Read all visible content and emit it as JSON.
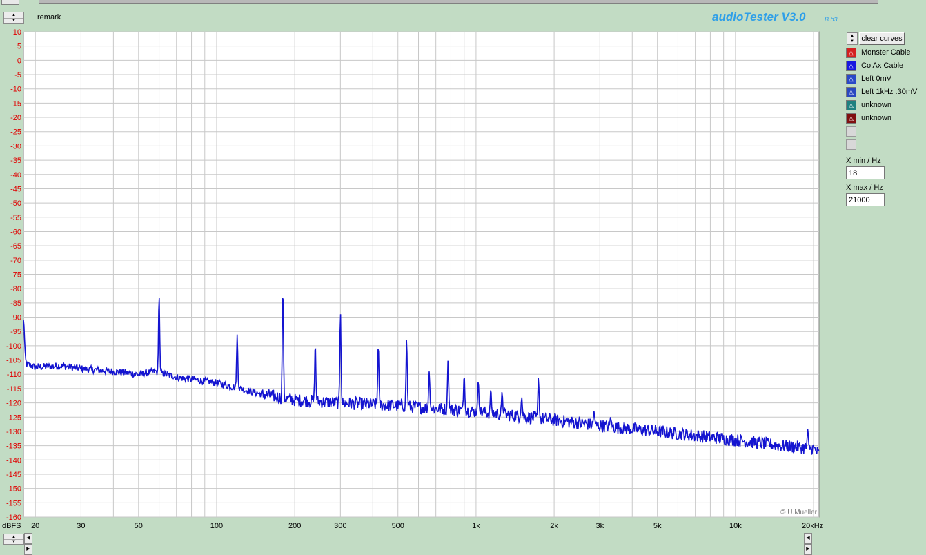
{
  "app": {
    "title": "audioTester V3.0",
    "subtitle": "B b3",
    "remark_label": "remark"
  },
  "legend": {
    "clear_label": "clear curves",
    "items": [
      {
        "label": "Monster Cable",
        "color": "#d42020"
      },
      {
        "label": "Co Ax Cable",
        "color": "#1818e0"
      },
      {
        "label": "Left 0mV",
        "color": "#2a48c8"
      },
      {
        "label": "Left 1kHz .30mV",
        "color": "#2a48c0"
      },
      {
        "label": "unknown",
        "color": "#1e8080"
      },
      {
        "label": "unknown",
        "color": "#801010"
      }
    ]
  },
  "fields": {
    "xmin_label": "X min / Hz",
    "xmin_value": "18",
    "xmax_label": "X max / Hz",
    "xmax_value": "21000"
  },
  "chart_data": {
    "type": "line",
    "title": "",
    "xlabel": "",
    "ylabel": "",
    "y_unit_label": "dBFS",
    "x_scale": "log",
    "xlim": [
      18,
      21000
    ],
    "ylim": [
      -160,
      10
    ],
    "y_ticks": [
      10,
      5,
      0,
      -5,
      -10,
      -15,
      -20,
      -25,
      -30,
      -35,
      -40,
      -45,
      -50,
      -55,
      -60,
      -65,
      -70,
      -75,
      -80,
      -85,
      -90,
      -95,
      -100,
      -105,
      -110,
      -115,
      -120,
      -125,
      -130,
      -135,
      -140,
      -145,
      -150,
      -155,
      -160
    ],
    "x_tick_labels": [
      {
        "v": 20,
        "label": "20"
      },
      {
        "v": 30,
        "label": "30"
      },
      {
        "v": 50,
        "label": "50"
      },
      {
        "v": 100,
        "label": "100"
      },
      {
        "v": 200,
        "label": "200"
      },
      {
        "v": 300,
        "label": "300"
      },
      {
        "v": 500,
        "label": "500"
      },
      {
        "v": 1000,
        "label": "1k"
      },
      {
        "v": 2000,
        "label": "2k"
      },
      {
        "v": 3000,
        "label": "3k"
      },
      {
        "v": 5000,
        "label": "5k"
      },
      {
        "v": 10000,
        "label": "10k"
      },
      {
        "v": 20000,
        "label": "20kHz"
      }
    ],
    "grid": true,
    "watermark": "© U.Mueller",
    "series": [
      {
        "color": "#1414d0",
        "baseline": [
          [
            18,
            -106
          ],
          [
            20,
            -107.5
          ],
          [
            25,
            -107
          ],
          [
            30,
            -108
          ],
          [
            40,
            -109
          ],
          [
            50,
            -110
          ],
          [
            58,
            -109
          ],
          [
            70,
            -111
          ],
          [
            100,
            -113
          ],
          [
            150,
            -117
          ],
          [
            200,
            -119
          ],
          [
            300,
            -120
          ],
          [
            500,
            -121
          ],
          [
            1000,
            -123
          ],
          [
            2000,
            -126
          ],
          [
            3000,
            -128
          ],
          [
            5000,
            -130
          ],
          [
            10000,
            -133
          ],
          [
            15000,
            -135
          ],
          [
            20000,
            -136
          ],
          [
            21000,
            -138
          ]
        ],
        "peaks": [
          [
            18,
            -91
          ],
          [
            60,
            -82
          ],
          [
            120,
            -96
          ],
          [
            180,
            -79
          ],
          [
            240,
            -99
          ],
          [
            300,
            -88
          ],
          [
            420,
            -99
          ],
          [
            540,
            -97
          ],
          [
            660,
            -109
          ],
          [
            780,
            -105
          ],
          [
            900,
            -110
          ],
          [
            1020,
            -112
          ],
          [
            1140,
            -115
          ],
          [
            1260,
            -116
          ],
          [
            1500,
            -118
          ],
          [
            1740,
            -111
          ],
          [
            2850,
            -123
          ],
          [
            3300,
            -125
          ],
          [
            19000,
            -129
          ]
        ]
      }
    ]
  }
}
